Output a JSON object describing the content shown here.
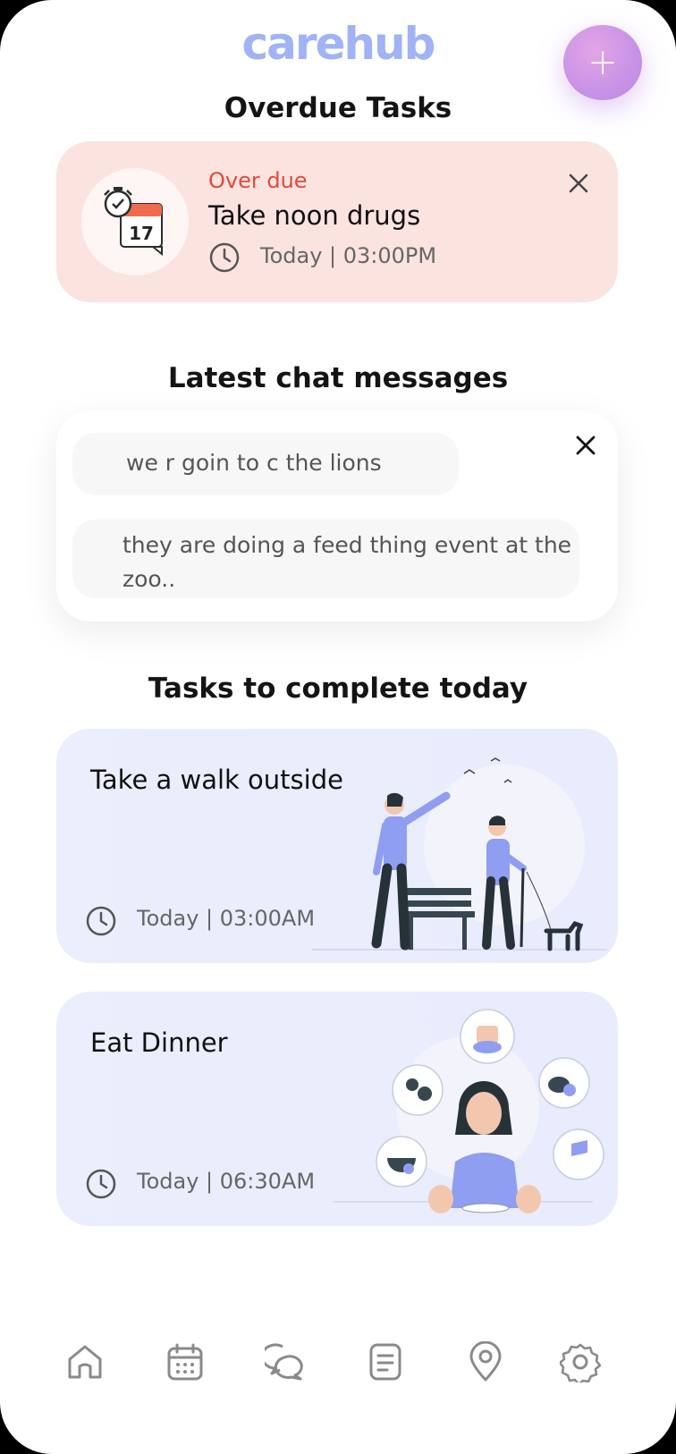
{
  "app": {
    "logo": "carehub"
  },
  "fab": {
    "label": "+"
  },
  "overdue": {
    "section_title": "Overdue Tasks",
    "calendar_day": "17",
    "status": "Over due",
    "title": "Take noon drugs",
    "time": "Today | 03:00PM"
  },
  "chat": {
    "section_title": "Latest chat messages",
    "messages": [
      "we r goin to c the lions",
      "they are doing a feed thing event at the zoo.."
    ]
  },
  "tasks": {
    "section_title": "Tasks to complete today",
    "items": [
      {
        "title": "Take a walk outside",
        "time": "Today | 03:00AM"
      },
      {
        "title": "Eat Dinner",
        "time": "Today | 06:30AM"
      }
    ]
  },
  "nav": {
    "items": [
      "home-icon",
      "calendar-icon",
      "chat-icon",
      "document-icon",
      "location-icon",
      "settings-icon"
    ]
  },
  "colors": {
    "brand": "#9fb3f5",
    "overdue_bg": "#fbe3e0",
    "overdue_text": "#e04a3a",
    "task_bg": "#ebeefc",
    "illustration": "#8f9ef0"
  }
}
